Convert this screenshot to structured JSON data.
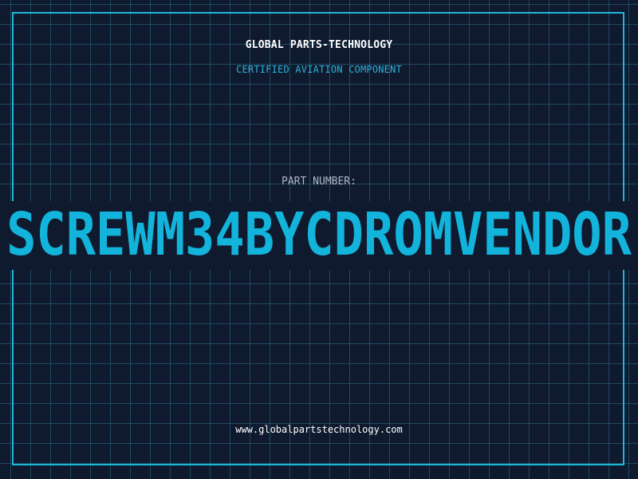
{
  "header": {
    "company_name": "GLOBAL PARTS-TECHNOLOGY",
    "tagline": "CERTIFIED AVIATION COMPONENT"
  },
  "part": {
    "label": "PART NUMBER:",
    "number": "SCREWM34BYCDROMVENDOR"
  },
  "footer": {
    "website": "www.globalpartstechnology.com"
  },
  "colors": {
    "background": "#0f1a2e",
    "grid": "#3082a0",
    "accent": "#13b4dc",
    "frame": "#1fb6d8"
  }
}
